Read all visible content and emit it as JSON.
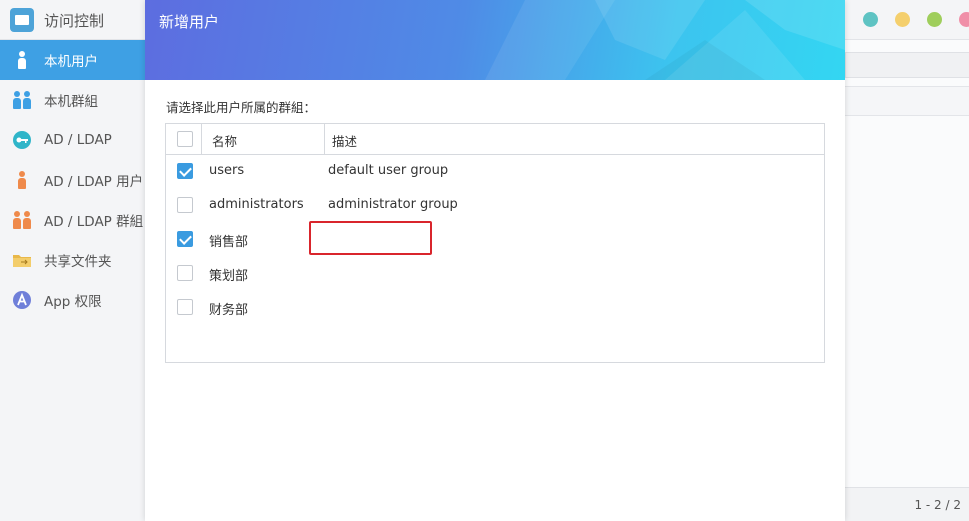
{
  "app": {
    "title": "访问控制"
  },
  "window_controls": [
    {
      "name": "teal",
      "color": "#5ec3c3"
    },
    {
      "name": "yellow",
      "color": "#f4cf6d"
    },
    {
      "name": "green",
      "color": "#9fce5c"
    },
    {
      "name": "pink",
      "color": "#f08fa8"
    }
  ],
  "sidebar": {
    "items": [
      {
        "label": "本机用户",
        "icon": "user-icon",
        "active": true
      },
      {
        "label": "本机群組",
        "icon": "group-icon",
        "active": false
      },
      {
        "label": "AD / LDAP",
        "icon": "key-icon",
        "active": false
      },
      {
        "label": "AD / LDAP 用户",
        "icon": "ldap-user-icon",
        "active": false
      },
      {
        "label": "AD / LDAP 群組",
        "icon": "ldap-group-icon",
        "active": false
      },
      {
        "label": "共享文件夹",
        "icon": "folder-icon",
        "active": false
      },
      {
        "label": "App 权限",
        "icon": "app-icon",
        "active": false
      }
    ]
  },
  "right_panel": {
    "pager": "1 - 2 / 2"
  },
  "modal": {
    "title": "新增用户",
    "prompt": "请选择此用户所属的群組：",
    "table": {
      "headers": {
        "name": "名称",
        "description": "描述"
      },
      "rows": [
        {
          "name": "users",
          "description": "default user group",
          "checked": true
        },
        {
          "name": "administrators",
          "description": "administrator group",
          "checked": false
        },
        {
          "name": "销售部",
          "description": "",
          "checked": true
        },
        {
          "name": "策划部",
          "description": "",
          "checked": false
        },
        {
          "name": "财务部",
          "description": "",
          "checked": false
        }
      ]
    }
  },
  "colors": {
    "accent": "#3ea0e4",
    "highlight": "#d9252c",
    "header_gradient_start": "#5d6de0",
    "header_gradient_end": "#33d6f2"
  }
}
